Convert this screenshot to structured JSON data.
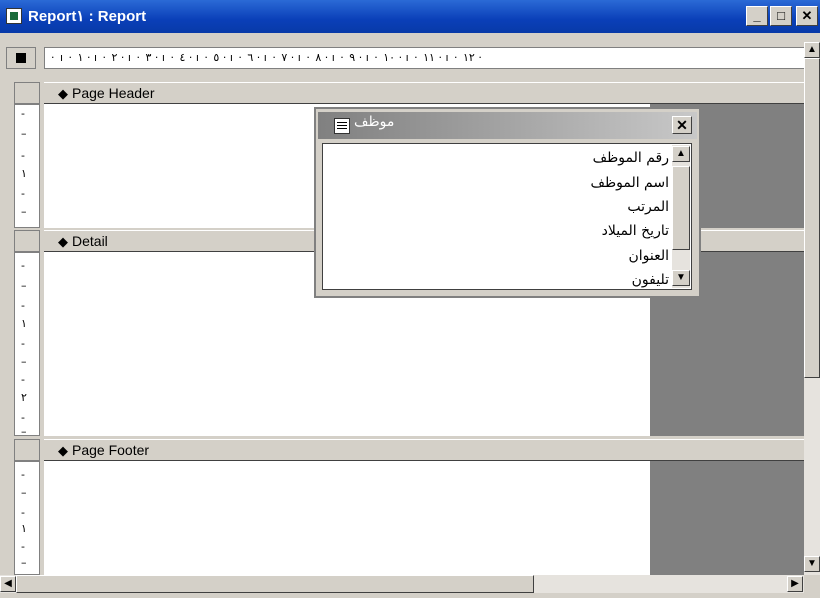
{
  "window": {
    "title": "Report١ : Report",
    "minimize": "_",
    "maximize": "□",
    "close": "✕",
    "icon": "report-icon"
  },
  "ruler": {
    "horizontal_text": "· ı · ١ · ı · ٢ · ı · ٣ · ı · ٤ · ı · ٥ · ı · ٦ · ı · ٧ · ı · ٨ · ı · ٩ · ı · ١٠ · ı · ١١ · ı · ١٢ ·",
    "v_one": "١",
    "v_two": "٢"
  },
  "sections": {
    "page_header": "Page Header",
    "detail": "Detail",
    "page_footer": "Page Footer"
  },
  "field_list": {
    "title": "موظف",
    "close": "✕",
    "fields": [
      "رقم الموظف",
      "اسم الموظف",
      "المرتب",
      "تاريخ الميلاد",
      "العنوان",
      "تليفون"
    ]
  },
  "icons": {
    "section_arrow": "◆"
  },
  "colors": {
    "titlebar": "#0a3fb8",
    "chrome": "#d4d0c8",
    "design_surface": "#ffffff",
    "beyond_width": "#808080"
  }
}
